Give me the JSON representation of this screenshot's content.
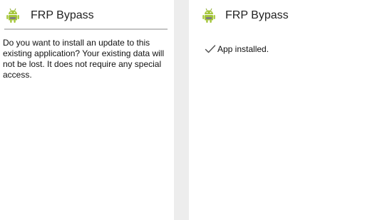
{
  "install_prompt_screen": {
    "app_name": "FRP Bypass",
    "icon": "android-robot-icon",
    "message": "Do you want to install an update to this existing application? Your existing data will not be lost. It does not require any special access."
  },
  "installed_screen": {
    "app_name": "FRP Bypass",
    "icon": "android-robot-icon",
    "status_icon": "checkmark-icon",
    "status": "App installed."
  },
  "colors": {
    "android_green": "#a4c639",
    "background": "#ffffff",
    "divider": "#c4c4c4"
  }
}
